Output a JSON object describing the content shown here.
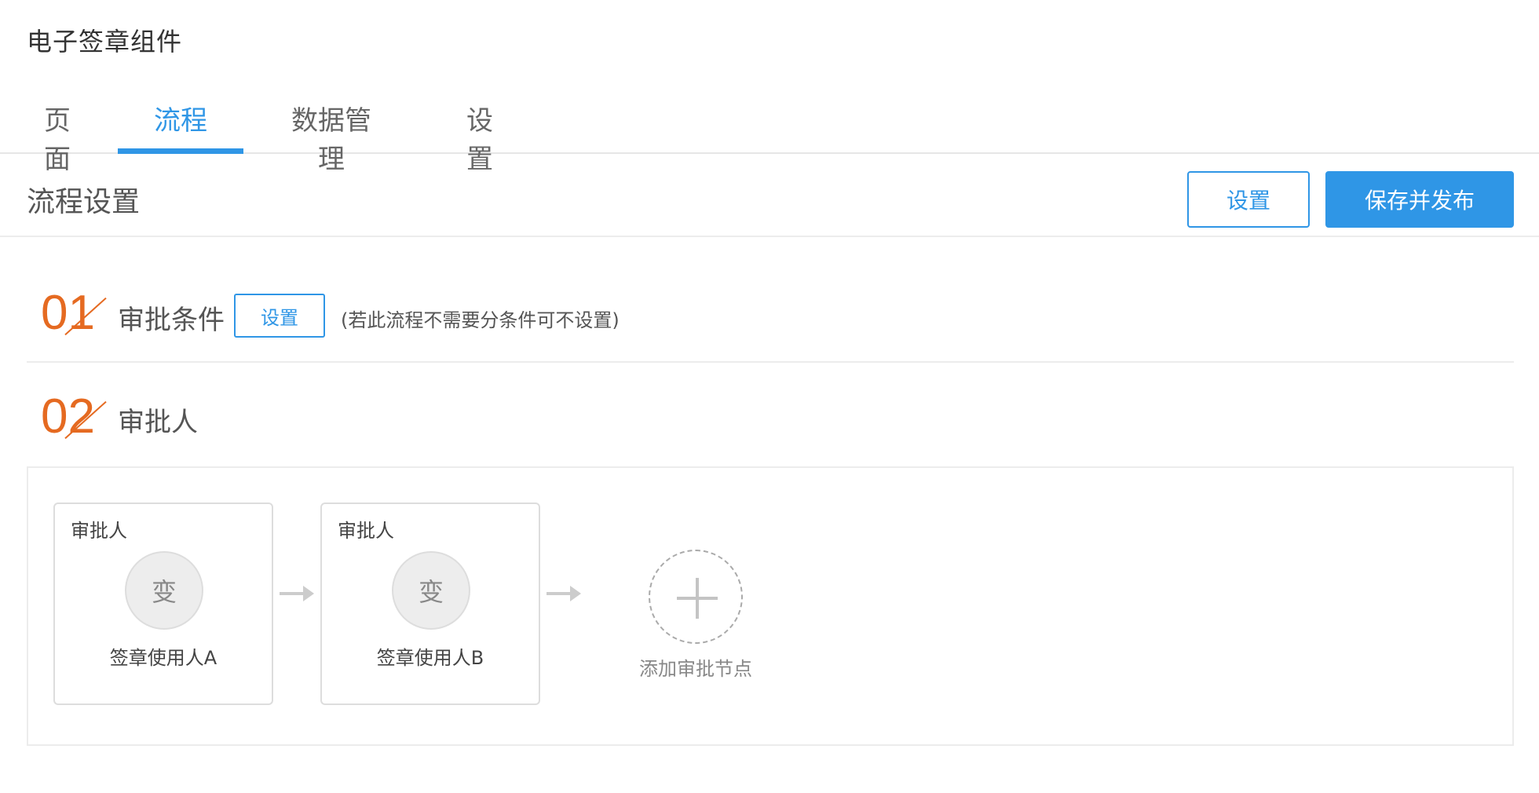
{
  "app": {
    "title": "电子签章组件"
  },
  "tabs": [
    {
      "label": "页面"
    },
    {
      "label": "流程"
    },
    {
      "label": "数据管理"
    },
    {
      "label": "设置"
    }
  ],
  "active_tab": "流程",
  "header": {
    "title": "流程设置",
    "settings_label": "设置",
    "publish_label": "保存并发布"
  },
  "steps": [
    {
      "number": "01",
      "label": "审批条件",
      "button_label": "设置",
      "hint": "(若此流程不需要分条件可不设置)"
    },
    {
      "number": "02",
      "label": "审批人"
    }
  ],
  "approval_nodes": [
    {
      "type": "审批人",
      "avatar_text": "变",
      "name": "签章使用人A"
    },
    {
      "type": "审批人",
      "avatar_text": "变",
      "name": "签章使用人B"
    }
  ],
  "add_node": {
    "label": "添加审批节点"
  },
  "colors": {
    "accent": "#2f96e6",
    "step_number": "#e56a21",
    "border": "#ececec"
  },
  "icons": {
    "arrow": "arrow-right-icon",
    "add": "plus-icon"
  }
}
